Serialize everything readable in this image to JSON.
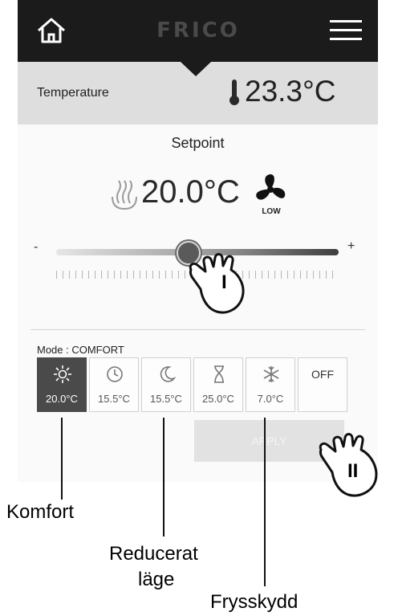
{
  "header": {
    "logo": "FRICO",
    "home_icon": "home-icon",
    "menu_icon": "hamburger-menu-icon",
    "bar_color": "#1b1b1b"
  },
  "temperature": {
    "label": "Temperature",
    "value": "23.3°C",
    "icon": "thermometer-icon"
  },
  "setpoint": {
    "label": "Setpoint",
    "value": "20.0°C",
    "heater_icon": "heating-icon",
    "fan_icon": "fan-icon",
    "fan_level": "LOW",
    "minus_label": "-",
    "plus_label": "+",
    "slider_value_fraction": 0.47
  },
  "mode": {
    "label": "Mode : COMFORT",
    "buttons": [
      {
        "icon": "sun-icon",
        "temp": "20.0°C",
        "selected": true
      },
      {
        "icon": "clock-icon",
        "temp": "15.5°C",
        "selected": false
      },
      {
        "icon": "moon-icon",
        "temp": "15.5°C",
        "selected": false
      },
      {
        "icon": "hourglass-icon",
        "temp": "25.0°C",
        "selected": false
      },
      {
        "icon": "snowflake-icon",
        "temp": "7.0°C",
        "selected": false
      },
      {
        "label": "OFF",
        "selected": false
      }
    ]
  },
  "apply_label": "APPLY",
  "annotations": {
    "hand_1_marker": "I",
    "hand_2_marker": "II",
    "komfort": "Komfort",
    "reducerat_line1": "Reducerat",
    "reducerat_line2": "läge",
    "frysskydd": "Frysskydd"
  }
}
